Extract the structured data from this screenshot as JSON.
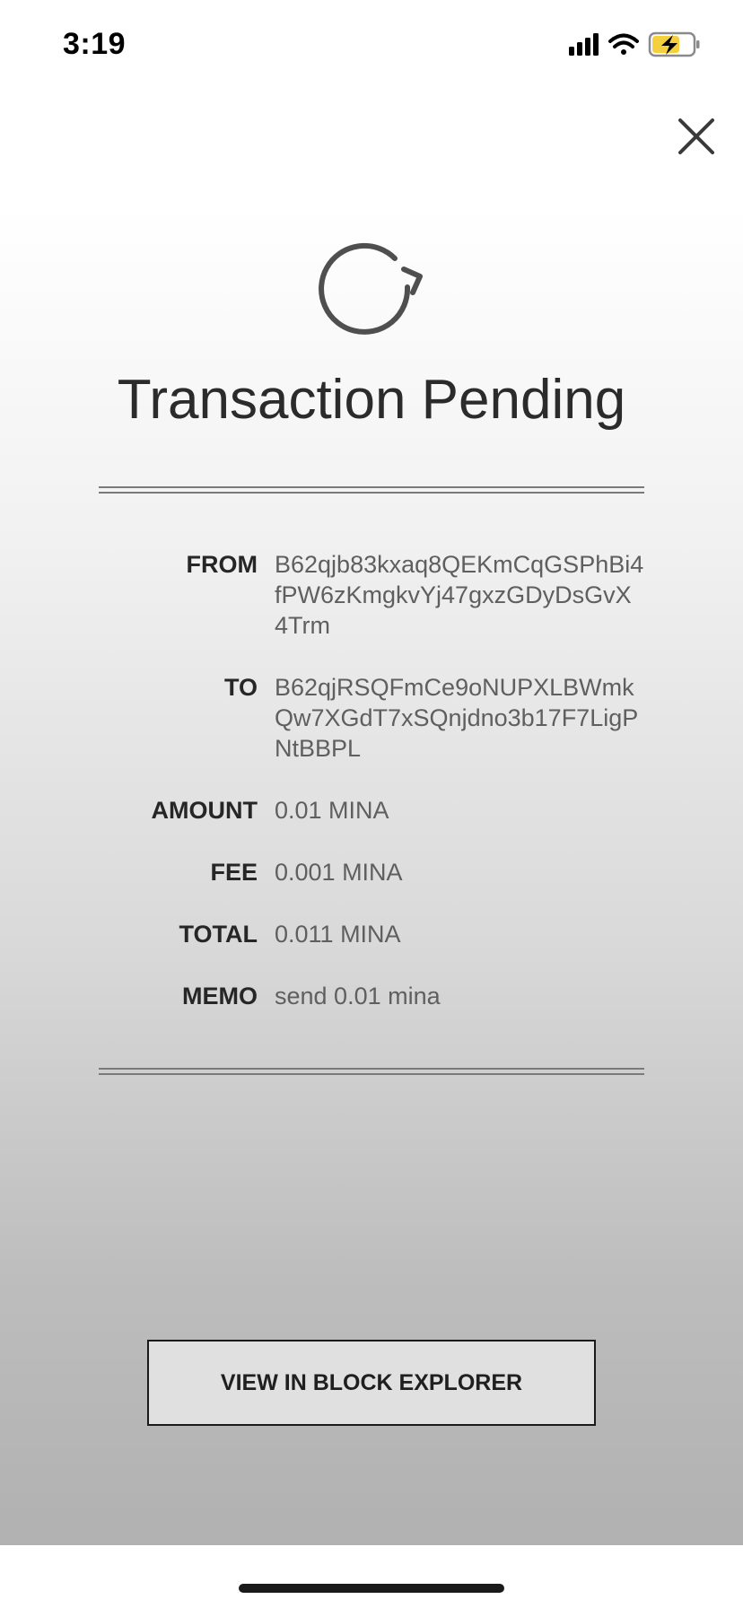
{
  "status_bar": {
    "time": "3:19",
    "icons": [
      "cellular-signal-icon",
      "wifi-icon",
      "battery-charging-icon"
    ],
    "battery_color": "#f4d03f"
  },
  "header": {
    "close_icon": "close-icon"
  },
  "transaction": {
    "status_icon": "refresh-icon",
    "title": "Transaction Pending",
    "fields": {
      "from": {
        "label": "FROM",
        "value": "B62qjb83kxaq8QEKmCqGSPhBi4fPW6zKmgkvYj47gxzGDyDsGvX4Trm"
      },
      "to": {
        "label": "TO",
        "value": "B62qjRSQFmCe9oNUPXLBWmkQw7XGdT7xSQnjdno3b17F7LigPNtBBPL"
      },
      "amount": {
        "label": "AMOUNT",
        "value": "0.01 MINA"
      },
      "fee": {
        "label": "FEE",
        "value": "0.001 MINA"
      },
      "total": {
        "label": "TOTAL",
        "value": "0.011 MINA"
      },
      "memo": {
        "label": "MEMO",
        "value": "send 0.01 mina"
      }
    }
  },
  "actions": {
    "explorer_label": "VIEW IN BLOCK EXPLORER"
  },
  "colors": {
    "title_text": "#2b2b2b",
    "label_text": "#262626",
    "value_text": "#5f5f5f",
    "button_border": "#1a1a1a"
  }
}
